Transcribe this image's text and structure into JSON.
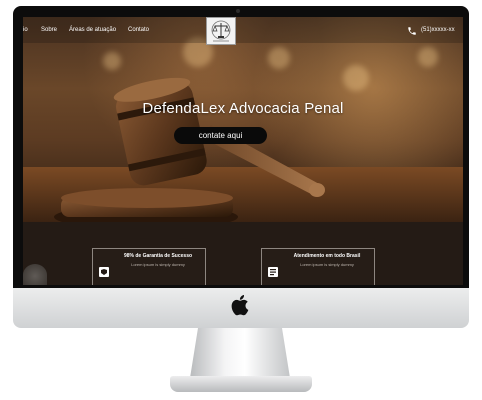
{
  "nav": {
    "partial_item": "io",
    "items": [
      "Sobre",
      "Áreas de atuação",
      "Contato"
    ],
    "phone": "(51)xxxxx-xx"
  },
  "hero": {
    "title": "DefendaLex Advocacia Penal",
    "cta_label": "contate aqui"
  },
  "features": [
    {
      "title": "98% de Garantia de Sucesso",
      "text": "Lorem ipsum is simply dummy"
    },
    {
      "title": "Atendimento em todo Brasil",
      "text": "Lorem ipsum is simply dummy"
    }
  ],
  "colors": {
    "bezel": "#0c0c0c",
    "lower_section": "#241b15",
    "cta_background": "#0a0a0a",
    "text": "#ffffff"
  },
  "icons": [
    "apple-logo",
    "balance-scale-logo",
    "phone-icon",
    "gavel-image",
    "shield-icon",
    "document-icon"
  ]
}
